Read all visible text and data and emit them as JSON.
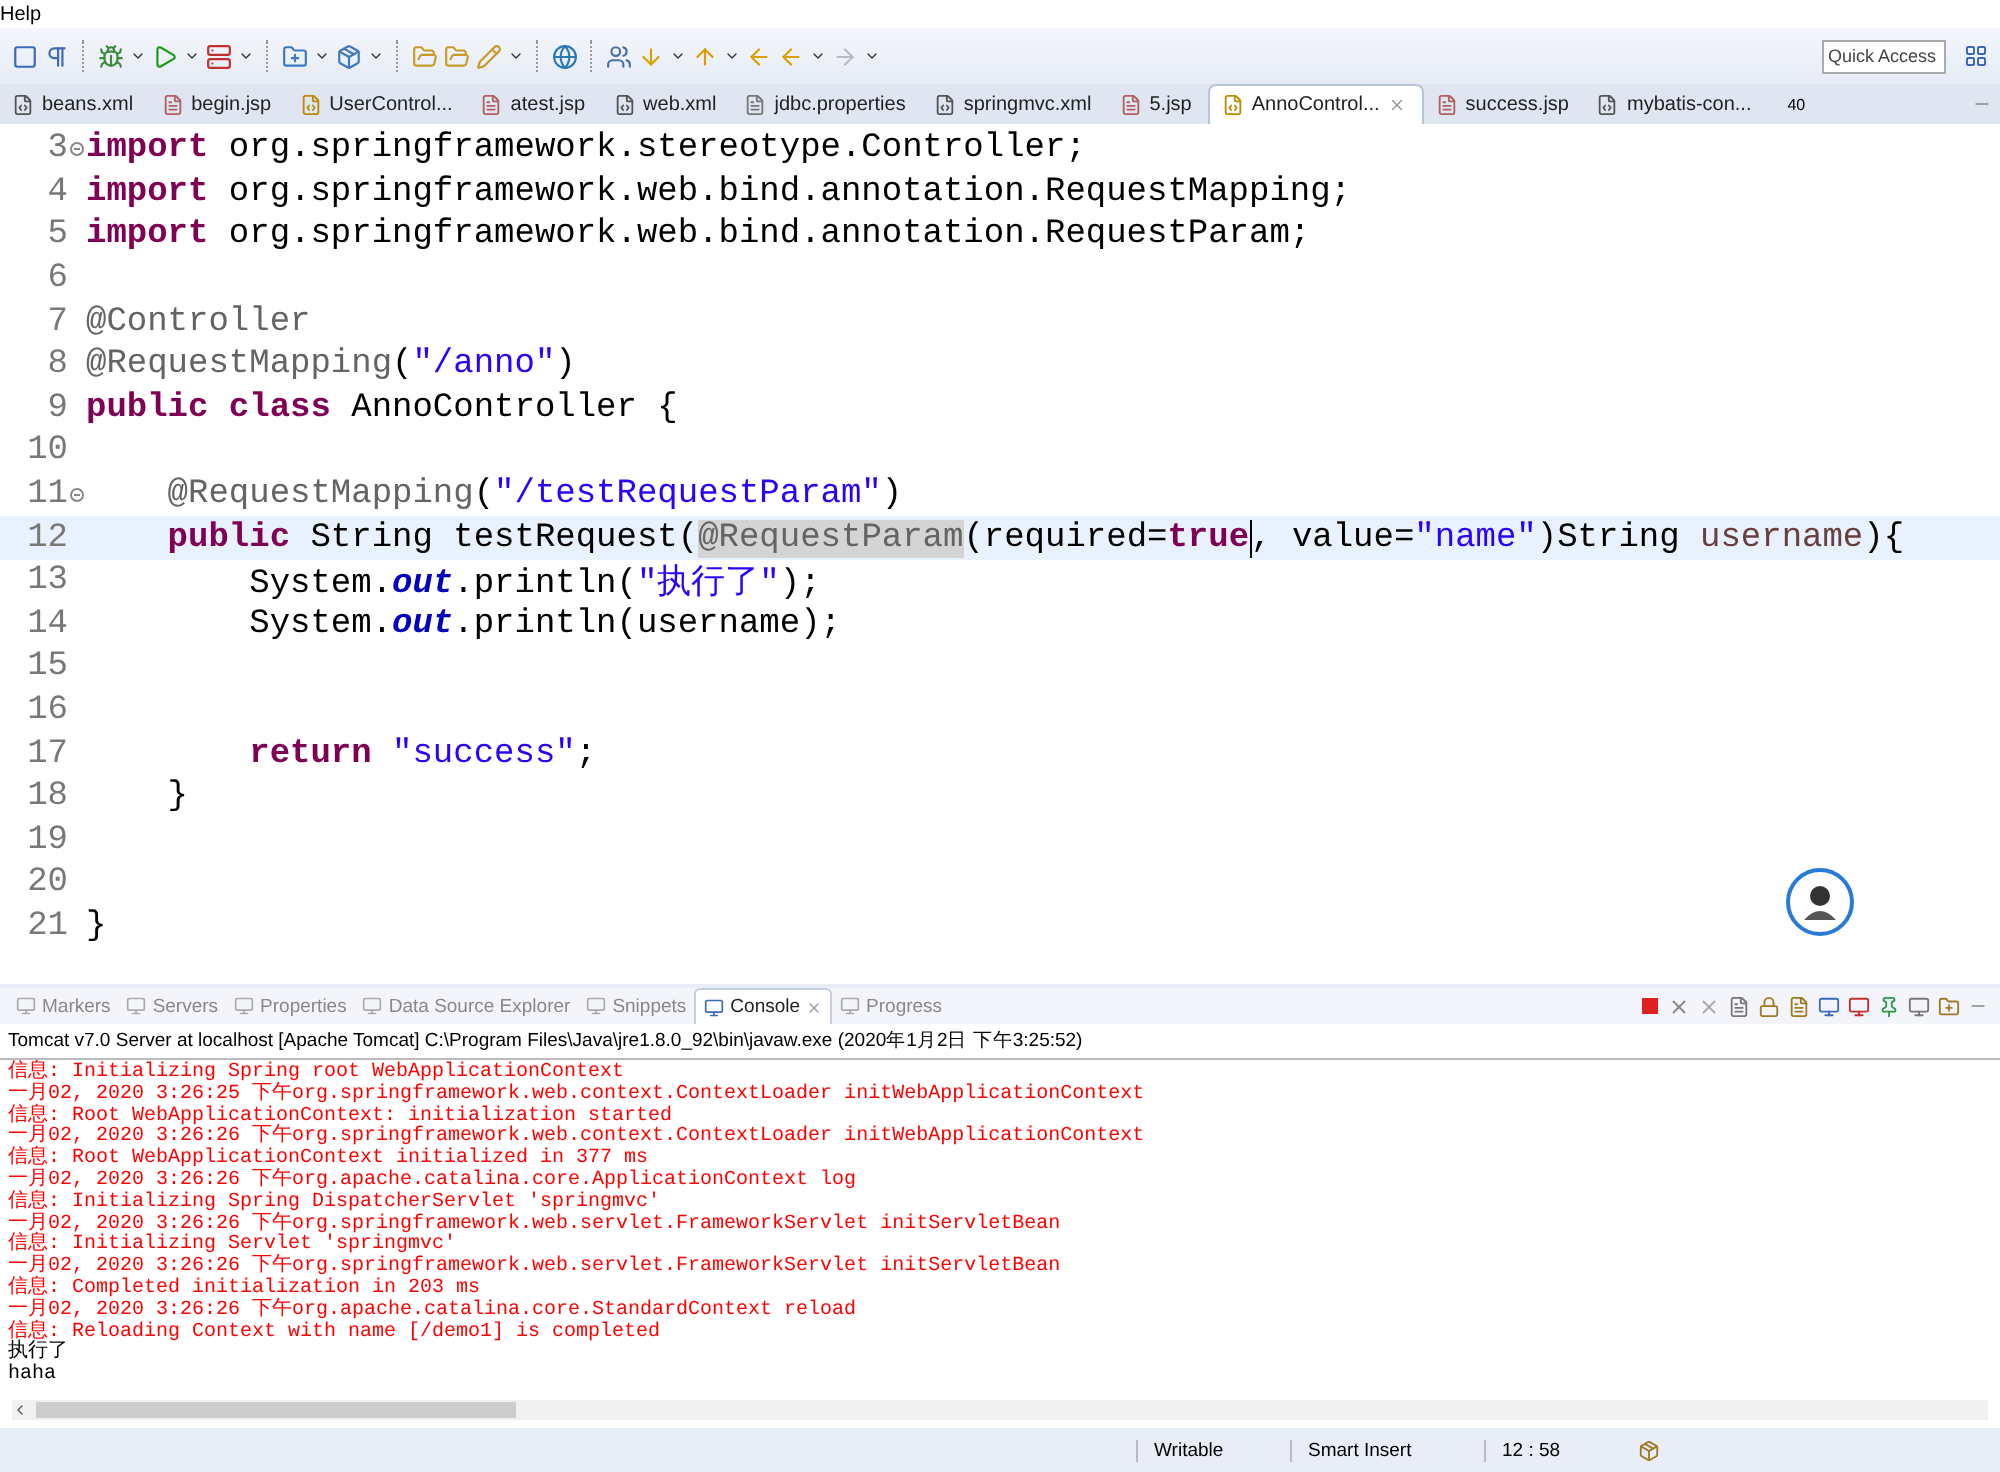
{
  "menu": [
    {
      "label": "Help"
    }
  ],
  "quick_access": {
    "placeholder": "Quick Access"
  },
  "editor_tabs": [
    {
      "label": "beans.xml",
      "kind": "xml",
      "selected": false
    },
    {
      "label": "begin.jsp",
      "kind": "jsp",
      "selected": false
    },
    {
      "label": "UserControl...",
      "kind": "java",
      "selected": false
    },
    {
      "label": "atest.jsp",
      "kind": "jsp",
      "selected": false
    },
    {
      "label": "web.xml",
      "kind": "xml",
      "selected": false
    },
    {
      "label": "jdbc.properties",
      "kind": "text",
      "selected": false
    },
    {
      "label": "springmvc.xml",
      "kind": "xml",
      "selected": false
    },
    {
      "label": "5.jsp",
      "kind": "jsp",
      "selected": false
    },
    {
      "label": "AnnoControl...",
      "kind": "java",
      "selected": true
    },
    {
      "label": "success.jsp",
      "kind": "jsp",
      "selected": false
    },
    {
      "label": "mybatis-con...",
      "kind": "xml",
      "selected": false
    }
  ],
  "tabs_overflow": "40",
  "code_lines": [
    {
      "number": "3",
      "fold": true,
      "current": false,
      "tokens": [
        {
          "kind": "keyword",
          "text": "import"
        },
        {
          "kind": "plain",
          "text": " org.springframework.stereotype.Controller;"
        }
      ]
    },
    {
      "number": "4",
      "fold": false,
      "current": false,
      "tokens": [
        {
          "kind": "keyword",
          "text": "import"
        },
        {
          "kind": "plain",
          "text": " org.springframework.web.bind.annotation.RequestMapping;"
        }
      ]
    },
    {
      "number": "5",
      "fold": false,
      "current": false,
      "tokens": [
        {
          "kind": "keyword",
          "text": "import"
        },
        {
          "kind": "plain",
          "text": " org.springframework.web.bind.annotation.RequestParam;"
        }
      ]
    },
    {
      "number": "6",
      "fold": false,
      "current": false
    },
    {
      "number": "7",
      "fold": false,
      "current": false,
      "tokens": [
        {
          "kind": "annotation",
          "text": "@Controller"
        }
      ]
    },
    {
      "number": "8",
      "fold": false,
      "current": false,
      "tokens": [
        {
          "kind": "annotation",
          "text": "@RequestMapping"
        },
        {
          "kind": "plain",
          "text": "("
        },
        {
          "kind": "string",
          "text": "\"/anno\""
        },
        {
          "kind": "plain",
          "text": ")"
        }
      ]
    },
    {
      "number": "9",
      "fold": false,
      "current": false,
      "tokens": [
        {
          "kind": "keyword",
          "text": "public class"
        },
        {
          "kind": "plain",
          "text": " AnnoController {"
        }
      ]
    },
    {
      "number": "10",
      "fold": false,
      "current": false
    },
    {
      "number": "11",
      "fold": true,
      "current": false,
      "tokens": [
        {
          "kind": "annotation",
          "text": "    @RequestMapping"
        },
        {
          "kind": "plain",
          "text": "("
        },
        {
          "kind": "string",
          "text": "\"/testRequestParam\""
        },
        {
          "kind": "plain",
          "text": ")"
        }
      ]
    },
    {
      "number": "12",
      "fold": false,
      "current": true,
      "tokens": [
        {
          "kind": "keyword",
          "text": "    public"
        },
        {
          "kind": "plain",
          "text": " String testRequest("
        },
        {
          "kind": "occurrence",
          "text": "@RequestParam"
        },
        {
          "kind": "plain",
          "text": "(required="
        },
        {
          "kind": "keyword",
          "text": "true",
          "cursor": true
        },
        {
          "kind": "plain",
          "text": ", value="
        },
        {
          "kind": "string",
          "text": "\"name\""
        },
        {
          "kind": "plain",
          "text": ")String "
        },
        {
          "kind": "param",
          "text": "username"
        },
        {
          "kind": "plain",
          "text": "){"
        }
      ]
    },
    {
      "number": "13",
      "fold": false,
      "current": false,
      "tokens": [
        {
          "kind": "plain",
          "text": "        System."
        },
        {
          "kind": "field",
          "text": "out"
        },
        {
          "kind": "plain",
          "text": ".println("
        },
        {
          "kind": "string",
          "text": "\"执行了\""
        },
        {
          "kind": "plain",
          "text": ");"
        }
      ]
    },
    {
      "number": "14",
      "fold": false,
      "current": false,
      "tokens": [
        {
          "kind": "plain",
          "text": "        System."
        },
        {
          "kind": "field",
          "text": "out"
        },
        {
          "kind": "plain",
          "text": ".println(username);"
        }
      ]
    },
    {
      "number": "15",
      "fold": false,
      "current": false
    },
    {
      "number": "16",
      "fold": false,
      "current": false
    },
    {
      "number": "17",
      "fold": false,
      "current": false,
      "tokens": [
        {
          "kind": "keyword",
          "text": "        return"
        },
        {
          "kind": "string",
          "text": " \"success\""
        },
        {
          "kind": "plain",
          "text": ";"
        }
      ]
    },
    {
      "number": "18",
      "fold": false,
      "current": false,
      "tokens": [
        {
          "kind": "plain",
          "text": "    }"
        }
      ]
    },
    {
      "number": "19",
      "fold": false,
      "current": false
    },
    {
      "number": "20",
      "fold": false,
      "current": false
    },
    {
      "number": "21",
      "fold": false,
      "current": false,
      "tokens": [
        {
          "kind": "plain",
          "text": "}"
        }
      ]
    }
  ],
  "view_tabs": [
    {
      "label": "Markers",
      "selected": false
    },
    {
      "label": "Servers",
      "selected": false
    },
    {
      "label": "Properties",
      "selected": false
    },
    {
      "label": "Data Source Explorer",
      "selected": false
    },
    {
      "label": "Snippets",
      "selected": false
    },
    {
      "label": "Console",
      "selected": true
    },
    {
      "label": "Progress",
      "selected": false
    }
  ],
  "console": {
    "title": "Tomcat v7.0 Server at localhost [Apache Tomcat] C:\\Program Files\\Java\\jre1.8.0_92\\bin\\javaw.exe (2020年1月2日 下午3:25:52)",
    "lines": [
      {
        "kind": "err",
        "text": "信息: Initializing Spring root WebApplicationContext"
      },
      {
        "kind": "err",
        "text": "一月02, 2020 3:26:25 下午org.springframework.web.context.ContextLoader initWebApplicationContext"
      },
      {
        "kind": "err",
        "text": "信息: Root WebApplicationContext: initialization started"
      },
      {
        "kind": "err",
        "text": "一月02, 2020 3:26:26 下午org.springframework.web.context.ContextLoader initWebApplicationContext"
      },
      {
        "kind": "err",
        "text": "信息: Root WebApplicationContext initialized in 377 ms"
      },
      {
        "kind": "err",
        "text": "一月02, 2020 3:26:26 下午org.apache.catalina.core.ApplicationContext log"
      },
      {
        "kind": "err",
        "text": "信息: Initializing Spring DispatcherServlet 'springmvc'"
      },
      {
        "kind": "err",
        "text": "一月02, 2020 3:26:26 下午org.springframework.web.servlet.FrameworkServlet initServletBean"
      },
      {
        "kind": "err",
        "text": "信息: Initializing Servlet 'springmvc'"
      },
      {
        "kind": "err",
        "text": "一月02, 2020 3:26:26 下午org.springframework.web.servlet.FrameworkServlet initServletBean"
      },
      {
        "kind": "err",
        "text": "信息: Completed initialization in 203 ms"
      },
      {
        "kind": "err",
        "text": "一月02, 2020 3:26:26 下午org.apache.catalina.core.StandardContext reload"
      },
      {
        "kind": "err",
        "text": "信息: Reloading Context with name [/demo1] is completed"
      },
      {
        "kind": "out",
        "text": "执行了"
      },
      {
        "kind": "out",
        "text": "haha"
      }
    ]
  },
  "status_bar": [
    {
      "text": "Writable"
    },
    {
      "text": "Smart Insert"
    },
    {
      "text": "12 : 58"
    }
  ]
}
